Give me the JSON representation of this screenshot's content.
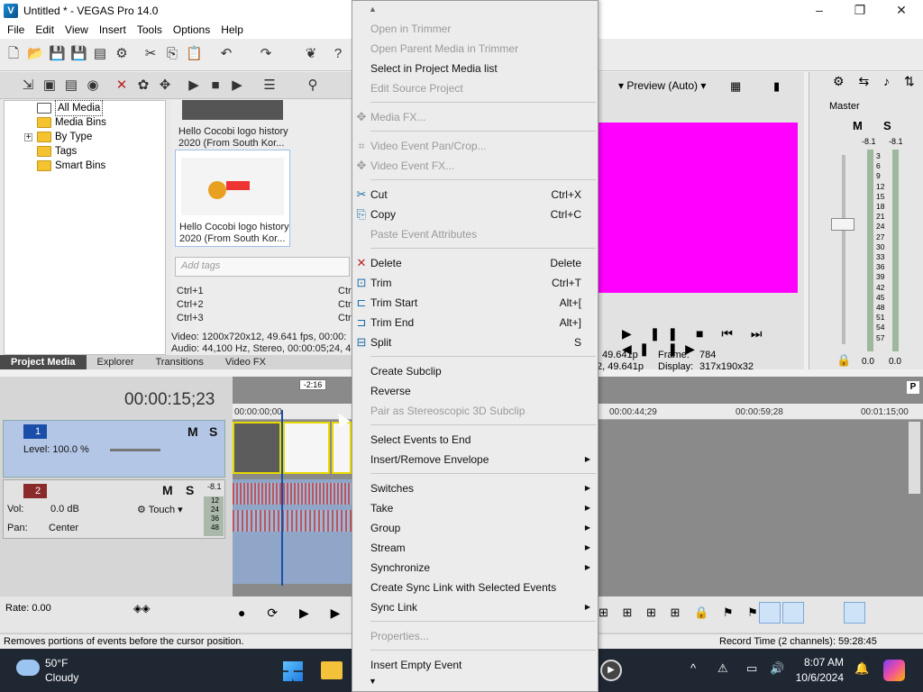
{
  "window": {
    "title": "Untitled * - VEGAS Pro 14.0",
    "minimize": "–",
    "maximize": "❐",
    "close": "✕"
  },
  "menubar": [
    "File",
    "Edit",
    "View",
    "Insert",
    "Tools",
    "Options",
    "Help"
  ],
  "media_tree": {
    "items": [
      "All Media",
      "Media Bins",
      "By Type",
      "Tags",
      "Smart Bins"
    ],
    "expand_marker": "+"
  },
  "thumbnails": [
    {
      "caption_line1": "Hello Cocobi logo history",
      "caption_line2": "2020 (From South Kor..."
    },
    {
      "caption_line1": "Hello Cocobi logo history",
      "caption_line2": "2020 (From South Kor..."
    }
  ],
  "tags": {
    "placeholder": "Add tags"
  },
  "shortcuts": [
    "Ctrl+1",
    "Ctrl+2",
    "Ctrl+3"
  ],
  "shortcuts_right": [
    "Ctr",
    "Ctr",
    "Ctr"
  ],
  "media_info": {
    "video": "Video: 1200x720x12, 49.641 fps, 00:00:",
    "audio": "Audio: 44,100 Hz, Stereo, 00:00:05;24, 4"
  },
  "bottom_tabs": [
    "Project Media",
    "Explorer",
    "Transitions",
    "Video FX"
  ],
  "preview": {
    "mode": "Preview (Auto)",
    "info_left1": "49.641p",
    "info_left2": "2, 49.641p",
    "frame_label": "Frame:",
    "frame_value": "784",
    "display_label": "Display:",
    "display_value": "317x190x32",
    "canvas_color": "#ff00ff"
  },
  "mixer": {
    "title": "Master",
    "m": "M",
    "s": "S",
    "peak_left": "-8.1",
    "peak_right": "-8.1",
    "scale": [
      "3",
      "6",
      "9",
      "12",
      "15",
      "18",
      "21",
      "24",
      "27",
      "30",
      "33",
      "36",
      "39",
      "42",
      "45",
      "48",
      "51",
      "54",
      "57"
    ],
    "bottom_left": "0.0",
    "bottom_right": "0.0"
  },
  "timeline": {
    "time": "00:00:15;23",
    "marker": "-2:16",
    "ruler": [
      "00:00:00;00",
      "00:00:44;29",
      "00:00:59;28",
      "00:01:15;00"
    ],
    "track1": {
      "number": "1",
      "level": "Level: 100.0 %",
      "m": "M",
      "s": "S"
    },
    "track2": {
      "number": "2",
      "vol_label": "Vol:",
      "vol_value": "0.0 dB",
      "pan_label": "Pan:",
      "pan_value": "Center",
      "touch": "Touch",
      "m": "M",
      "s": "S",
      "meter_top": "-8.1",
      "meter_scale": [
        "12",
        "24",
        "36",
        "48"
      ]
    },
    "rate": "Rate: 0.00"
  },
  "status": {
    "left": "Removes portions of events before the cursor position.",
    "right": "Record Time (2 channels): 59:28:45"
  },
  "context_menu": [
    {
      "label": "Open in Trimmer",
      "disabled": true
    },
    {
      "label": "Open Parent Media in Trimmer",
      "disabled": true
    },
    {
      "label": "Select in Project Media list",
      "disabled": false
    },
    {
      "label": "Edit Source Project",
      "disabled": true
    },
    {
      "sep": true
    },
    {
      "label": "Media FX...",
      "disabled": true,
      "icon": "media-fx-icon"
    },
    {
      "sep": true
    },
    {
      "label": "Video Event Pan/Crop...",
      "disabled": true,
      "icon": "pan-crop-icon"
    },
    {
      "label": "Video Event FX...",
      "disabled": true,
      "icon": "video-fx-icon"
    },
    {
      "sep": true
    },
    {
      "label": "Cut",
      "shortcut": "Ctrl+X",
      "disabled": false,
      "icon": "scissors-icon"
    },
    {
      "label": "Copy",
      "shortcut": "Ctrl+C",
      "disabled": false,
      "icon": "copy-icon"
    },
    {
      "label": "Paste Event Attributes",
      "disabled": true
    },
    {
      "sep": true
    },
    {
      "label": "Delete",
      "shortcut": "Delete",
      "disabled": false,
      "icon": "delete-icon"
    },
    {
      "label": "Trim",
      "shortcut": "Ctrl+T",
      "disabled": false,
      "icon": "trim-icon"
    },
    {
      "label": "Trim Start",
      "shortcut": "Alt+[",
      "disabled": false,
      "icon": "trim-start-icon"
    },
    {
      "label": "Trim End",
      "shortcut": "Alt+]",
      "disabled": false,
      "icon": "trim-end-icon"
    },
    {
      "label": "Split",
      "shortcut": "S",
      "disabled": false,
      "icon": "split-icon"
    },
    {
      "sep": true
    },
    {
      "label": "Create Subclip",
      "disabled": false
    },
    {
      "label": "Reverse",
      "disabled": false
    },
    {
      "label": "Pair as Stereoscopic 3D Subclip",
      "disabled": true
    },
    {
      "sep": true
    },
    {
      "label": "Select Events to End",
      "disabled": false
    },
    {
      "label": "Insert/Remove Envelope",
      "disabled": false,
      "submenu": true
    },
    {
      "sep": true
    },
    {
      "label": "Switches",
      "disabled": false,
      "submenu": true
    },
    {
      "label": "Take",
      "disabled": false,
      "submenu": true
    },
    {
      "label": "Group",
      "disabled": false,
      "submenu": true
    },
    {
      "label": "Stream",
      "disabled": false,
      "submenu": true
    },
    {
      "label": "Synchronize",
      "disabled": false,
      "submenu": true
    },
    {
      "label": "Create Sync Link with Selected Events",
      "disabled": false
    },
    {
      "label": "Sync Link",
      "disabled": false,
      "submenu": true
    },
    {
      "sep": true
    },
    {
      "label": "Properties...",
      "disabled": true
    },
    {
      "sep": true
    },
    {
      "label": "Insert Empty Event",
      "disabled": false
    }
  ],
  "taskbar": {
    "temperature": "50°F",
    "condition": "Cloudy",
    "time": "8:07 AM",
    "date": "10/6/2024",
    "up_arrow": "^"
  },
  "colors": {
    "accent": "#1b4ea8",
    "preview": "#ff00ff",
    "taskbar": "#1f2733"
  }
}
